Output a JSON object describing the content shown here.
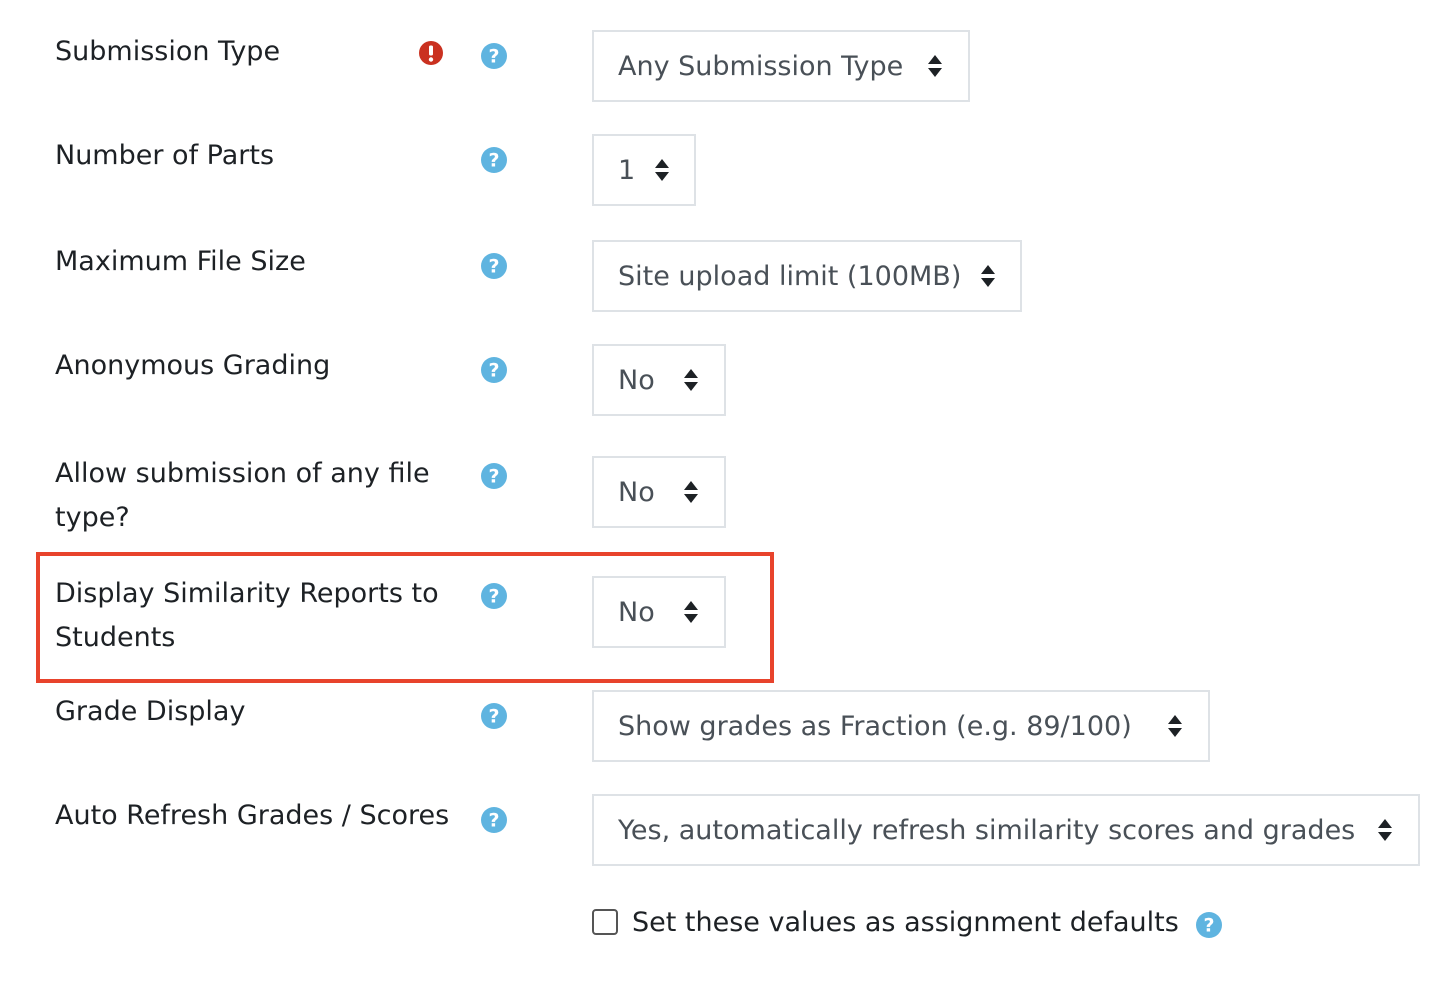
{
  "colors": {
    "help_icon": "#5fb4e0",
    "required_icon": "#ca3120",
    "highlight_border": "#e8432c",
    "select_border": "#dee2e6"
  },
  "fields": {
    "submission_type": {
      "label": "Submission Type",
      "value": "Any Submission Type",
      "required": true,
      "help_icon": "question-circle-icon"
    },
    "number_of_parts": {
      "label": "Number of Parts",
      "value": "1",
      "help_icon": "question-circle-icon"
    },
    "max_file_size": {
      "label": "Maximum File Size",
      "value": "Site upload limit (100MB)",
      "help_icon": "question-circle-icon"
    },
    "anonymous_grading": {
      "label": "Anonymous Grading",
      "value": "No",
      "help_icon": "question-circle-icon"
    },
    "allow_any_file": {
      "label_line1": "Allow submission of any file",
      "label_line2": "type?",
      "value": "No",
      "help_icon": "question-circle-icon"
    },
    "display_similarity": {
      "label_line1": "Display Similarity Reports to",
      "label_line2": "Students",
      "value": "No",
      "help_icon": "question-circle-icon",
      "highlighted": true
    },
    "grade_display": {
      "label": "Grade Display",
      "value": "Show grades as Fraction (e.g. 89/100)",
      "help_icon": "question-circle-icon"
    },
    "auto_refresh": {
      "label": "Auto Refresh Grades / Scores",
      "value": "Yes, automatically refresh similarity scores and grades",
      "help_icon": "question-circle-icon"
    }
  },
  "defaults_checkbox": {
    "label": "Set these values as assignment defaults",
    "checked": false,
    "help_icon": "question-circle-icon"
  }
}
